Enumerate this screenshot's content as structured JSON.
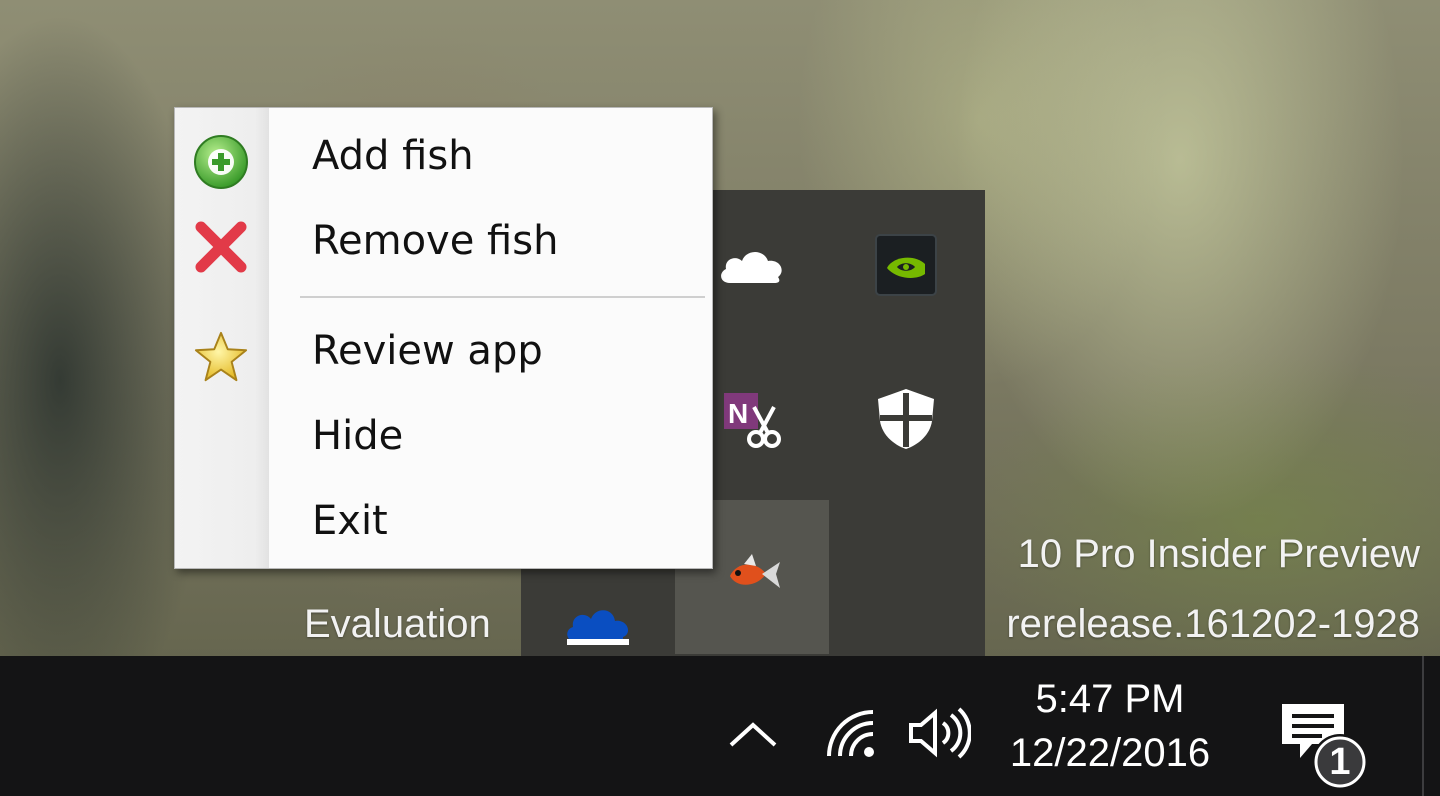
{
  "desktop": {
    "watermark_line1": "10 Pro Insider Preview",
    "watermark_line2_left": "Evaluation",
    "watermark_line2_right": "rerelease.161202-1928"
  },
  "context_menu": {
    "items": [
      {
        "label": "Add fish",
        "icon": "green-plus-circle-icon"
      },
      {
        "label": "Remove fish",
        "icon": "red-x-icon"
      },
      {
        "label": "Review app",
        "icon": "yellow-star-icon"
      },
      {
        "label": "Hide",
        "icon": ""
      },
      {
        "label": "Exit",
        "icon": ""
      }
    ]
  },
  "tray_flyout": {
    "icons": [
      "onedrive-icon",
      "nvidia-icon",
      "onenote-clipper-icon",
      "windows-defender-icon",
      "onedrive-business-icon",
      "goldfish-app-icon"
    ]
  },
  "taskbar": {
    "time": "5:47 PM",
    "date": "12/22/2016",
    "notification_count": "1",
    "icons": [
      "show-hidden-icons-chevron",
      "network-wifi-icon",
      "volume-icon",
      "action-center-icon"
    ]
  },
  "colors": {
    "taskbar_bg": "#141415",
    "flyout_bg": "#3b3b37",
    "menu_bg": "#fbfbfb",
    "nvidia_green": "#76b900",
    "onenote_purple": "#80397b",
    "onedrive_blue": "#0a4ec1"
  }
}
